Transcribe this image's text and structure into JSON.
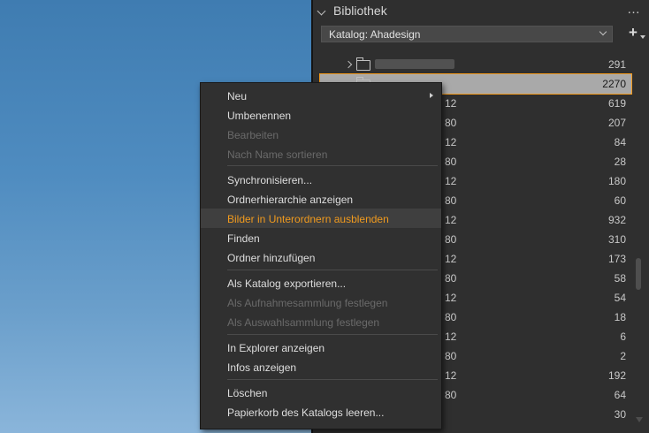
{
  "panel": {
    "title": "Bibliothek",
    "more_label": "…",
    "catalog_label": "Katalog: Ahadesign",
    "add_label": "+"
  },
  "tree_rows": [
    {
      "label": "",
      "count": "291",
      "state": "collapsed"
    },
    {
      "label": "",
      "count": "2270",
      "state": "selected"
    },
    {
      "label": "12",
      "count": "619"
    },
    {
      "label": "80",
      "count": "207"
    },
    {
      "label": "12",
      "count": "84"
    },
    {
      "label": "80",
      "count": "28"
    },
    {
      "label": "12",
      "count": "180"
    },
    {
      "label": "80",
      "count": "60"
    },
    {
      "label": "12",
      "count": "932"
    },
    {
      "label": "80",
      "count": "310"
    },
    {
      "label": "12",
      "count": "173"
    },
    {
      "label": "80",
      "count": "58"
    },
    {
      "label": "12",
      "count": "54"
    },
    {
      "label": "80",
      "count": "18"
    },
    {
      "label": "12",
      "count": "6"
    },
    {
      "label": "80",
      "count": "2"
    },
    {
      "label": "12",
      "count": "192"
    },
    {
      "label": "80",
      "count": "64"
    },
    {
      "label": "",
      "count": "30"
    }
  ],
  "context_menu": {
    "items": [
      {
        "label": "Neu",
        "enabled": true,
        "submenu": true
      },
      {
        "label": "Umbenennen",
        "enabled": true
      },
      {
        "label": "Bearbeiten",
        "enabled": false
      },
      {
        "label": "Nach Name sortieren",
        "enabled": false
      },
      {
        "label": "Synchronisieren...",
        "enabled": true
      },
      {
        "label": "Ordnerhierarchie anzeigen",
        "enabled": true
      },
      {
        "label": "Bilder in Unterordnern ausblenden",
        "enabled": true,
        "highlighted": true
      },
      {
        "label": "Finden",
        "enabled": true
      },
      {
        "label": "Ordner hinzufügen",
        "enabled": true
      },
      {
        "label": "Als Katalog exportieren...",
        "enabled": true
      },
      {
        "label": "Als Aufnahmesammlung festlegen",
        "enabled": false
      },
      {
        "label": "Als Auswahlsammlung festlegen",
        "enabled": false
      },
      {
        "label": "In Explorer anzeigen",
        "enabled": true
      },
      {
        "label": "Infos anzeigen",
        "enabled": true
      },
      {
        "label": "Löschen",
        "enabled": true
      },
      {
        "label": "Papierkorb des Katalogs leeren...",
        "enabled": true
      }
    ]
  },
  "colors": {
    "accent": "#f09a1e",
    "selection": "#a9a9a9",
    "panel_bg": "#2f2f2f",
    "menu_bg": "#303030"
  }
}
